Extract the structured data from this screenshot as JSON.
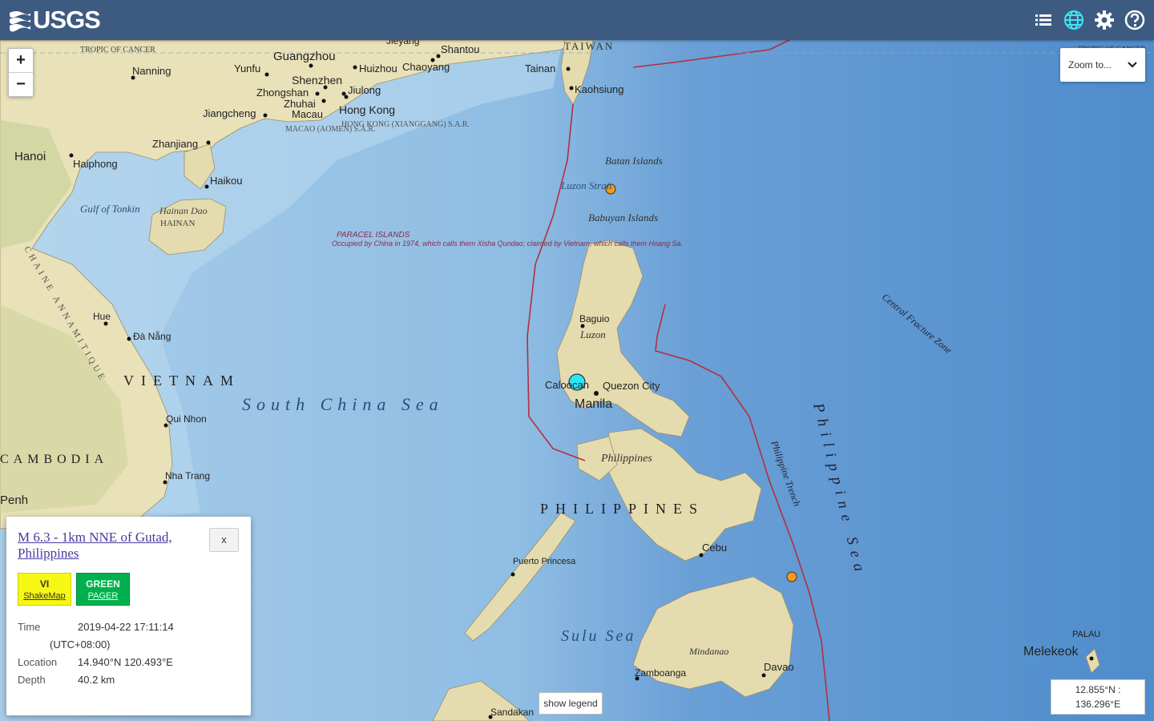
{
  "header": {
    "logo_text": "USGS",
    "icons": [
      "list-icon",
      "globe-icon",
      "gear-icon",
      "help-icon"
    ]
  },
  "map": {
    "zoom_in": "+",
    "zoom_out": "−",
    "zoom_to_label": "Zoom to...",
    "places": {
      "tropic_left": "TROPIC OF CANCER",
      "tropic_right": "TROPIC OF CANCER",
      "guangzhou": "Guangzhou",
      "nanning": "Nanning",
      "yunfu": "Yunfu",
      "huizhou": "Huizhou",
      "chaoyang": "Chaoyang",
      "shantou": "Shantou",
      "jieyang": "Jieyang",
      "shenzhen": "Shenzhen",
      "zhongshan": "Zhongshan",
      "jiulong": "Jiulong",
      "zhuhai": "Zhuhai",
      "macau": "Macau",
      "hongkong": "Hong Kong",
      "jiangcheng": "Jiangcheng",
      "macao_sar": "MACAO (AOMEN) S.A.R.",
      "hk_sar": "HONG KONG (XIANGGANG) S.A.R.",
      "zhanjiang": "Zhanjiang",
      "hanoi": "Hanoi",
      "haiphong": "Haiphong",
      "haikou": "Haikou",
      "gulf_tonkin": "Gulf of Tonkin",
      "hainan": "Hainan Dao",
      "hainan_caps": "HAINAN",
      "taiwan": "TAIWAN",
      "tainan": "Tainan",
      "kaohsiung": "Kaohsiung",
      "batan": "Batan Islands",
      "luzon_strait": "Luzon Strait",
      "babuyan": "Babuyan Islands",
      "paracel_title": "PARACEL ISLANDS",
      "paracel_note": "Occupied by China in 1974, which calls them Xisha Qundao; claimed by Vietnam, which calls them Hoang Sa.",
      "baguio": "Baguio",
      "luzon": "Luzon",
      "caloocan": "Caloocan",
      "quezon": "Quezon City",
      "manila": "Manila",
      "philippines_lc": "Philippines",
      "philippines": "PHILIPPINES",
      "hue": "Hue",
      "danang": "Đà Nẵng",
      "vietnam": "VIETNAM",
      "annamitique": "CHAINE ANNAMITIQUE",
      "scs": "South China Sea",
      "quinhon": "Qui Nhon",
      "nhatrang": "Nha Trang",
      "cambodia": "CAMBODIA",
      "penh": "Penh",
      "central_fracture": "Central Fracture Zone",
      "phil_sea": "Philippine Sea",
      "phil_trench": "Philippine Trench",
      "cebu": "Cebu",
      "puerto": "Puerto Princesa",
      "sulu": "Sulu Sea",
      "mindanao": "Mindanao",
      "zamboanga": "Zamboanga",
      "davao": "Davao",
      "palau": "PALAU",
      "melekeok": "Melekeok",
      "sandakan": "Sandakan"
    }
  },
  "popup": {
    "title": "M 6.3 - 1km NNE of Gutad, Philippines",
    "close": "x",
    "shakemap_value": "VI",
    "shakemap_label": "ShakeMap",
    "pager_value": "GREEN",
    "pager_label": "PAGER",
    "time_label": "Time",
    "time_value": "2019-04-22 17:11:14",
    "time_zone": "(UTC+08:00)",
    "location_label": "Location",
    "location_value": "14.940°N 120.493°E",
    "depth_label": "Depth",
    "depth_value": "40.2 km"
  },
  "footer": {
    "legend_button": "show legend",
    "coord_lat": "12.855°N :",
    "coord_lon": "136.296°E"
  },
  "colors": {
    "header": "#3d5a80",
    "ocean": "#9ec4e6",
    "land": "#e9e1b8",
    "selected_quake": "#2fe6f0",
    "other_quake": "#f79a16",
    "plate_boundary": "#b2303c"
  }
}
